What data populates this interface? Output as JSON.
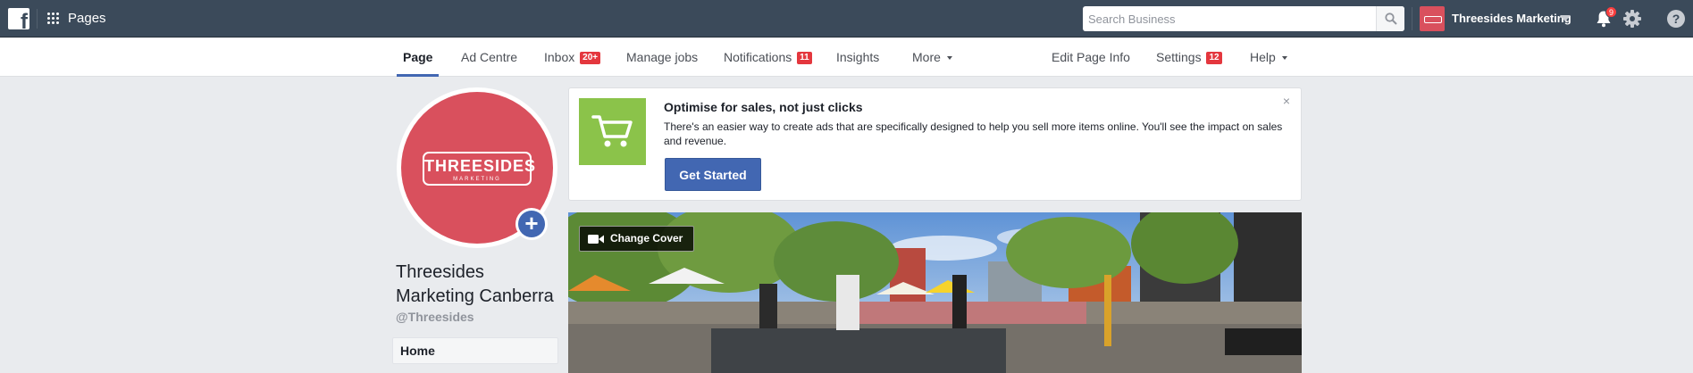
{
  "topbar": {
    "section_label": "Pages",
    "search_placeholder": "Search Business",
    "business_name": "Threesides Marketing",
    "notification_count": "9"
  },
  "page_nav": {
    "tabs": [
      {
        "label": "Page",
        "active": true
      },
      {
        "label": "Ad Centre"
      },
      {
        "label": "Inbox",
        "badge": "20+"
      },
      {
        "label": "Manage jobs"
      },
      {
        "label": "Notifications",
        "badge": "11"
      },
      {
        "label": "Insights"
      },
      {
        "label": "More"
      }
    ],
    "right": [
      {
        "label": "Edit Page Info"
      },
      {
        "label": "Settings",
        "badge": "12"
      },
      {
        "label": "Help"
      }
    ]
  },
  "profile": {
    "logo_main": "THREESIDES",
    "logo_sub": "MARKETING",
    "name_line1": "Threesides",
    "name_line2": "Marketing Canberra",
    "handle": "@Threesides",
    "nav_home": "Home"
  },
  "promo": {
    "title": "Optimise for sales, not just clicks",
    "body": "There's an easier way to create ads that are specifically designed to help you sell more items online. You'll see the impact on sales and revenue.",
    "cta": "Get Started",
    "close": "×"
  },
  "cover": {
    "change_label": "Change Cover"
  },
  "colors": {
    "topbar": "#3b4a5a",
    "brand_red": "#d9505d",
    "accent_blue": "#4267b2",
    "badge_red": "#e4373e",
    "promo_green": "#8bc34a"
  }
}
